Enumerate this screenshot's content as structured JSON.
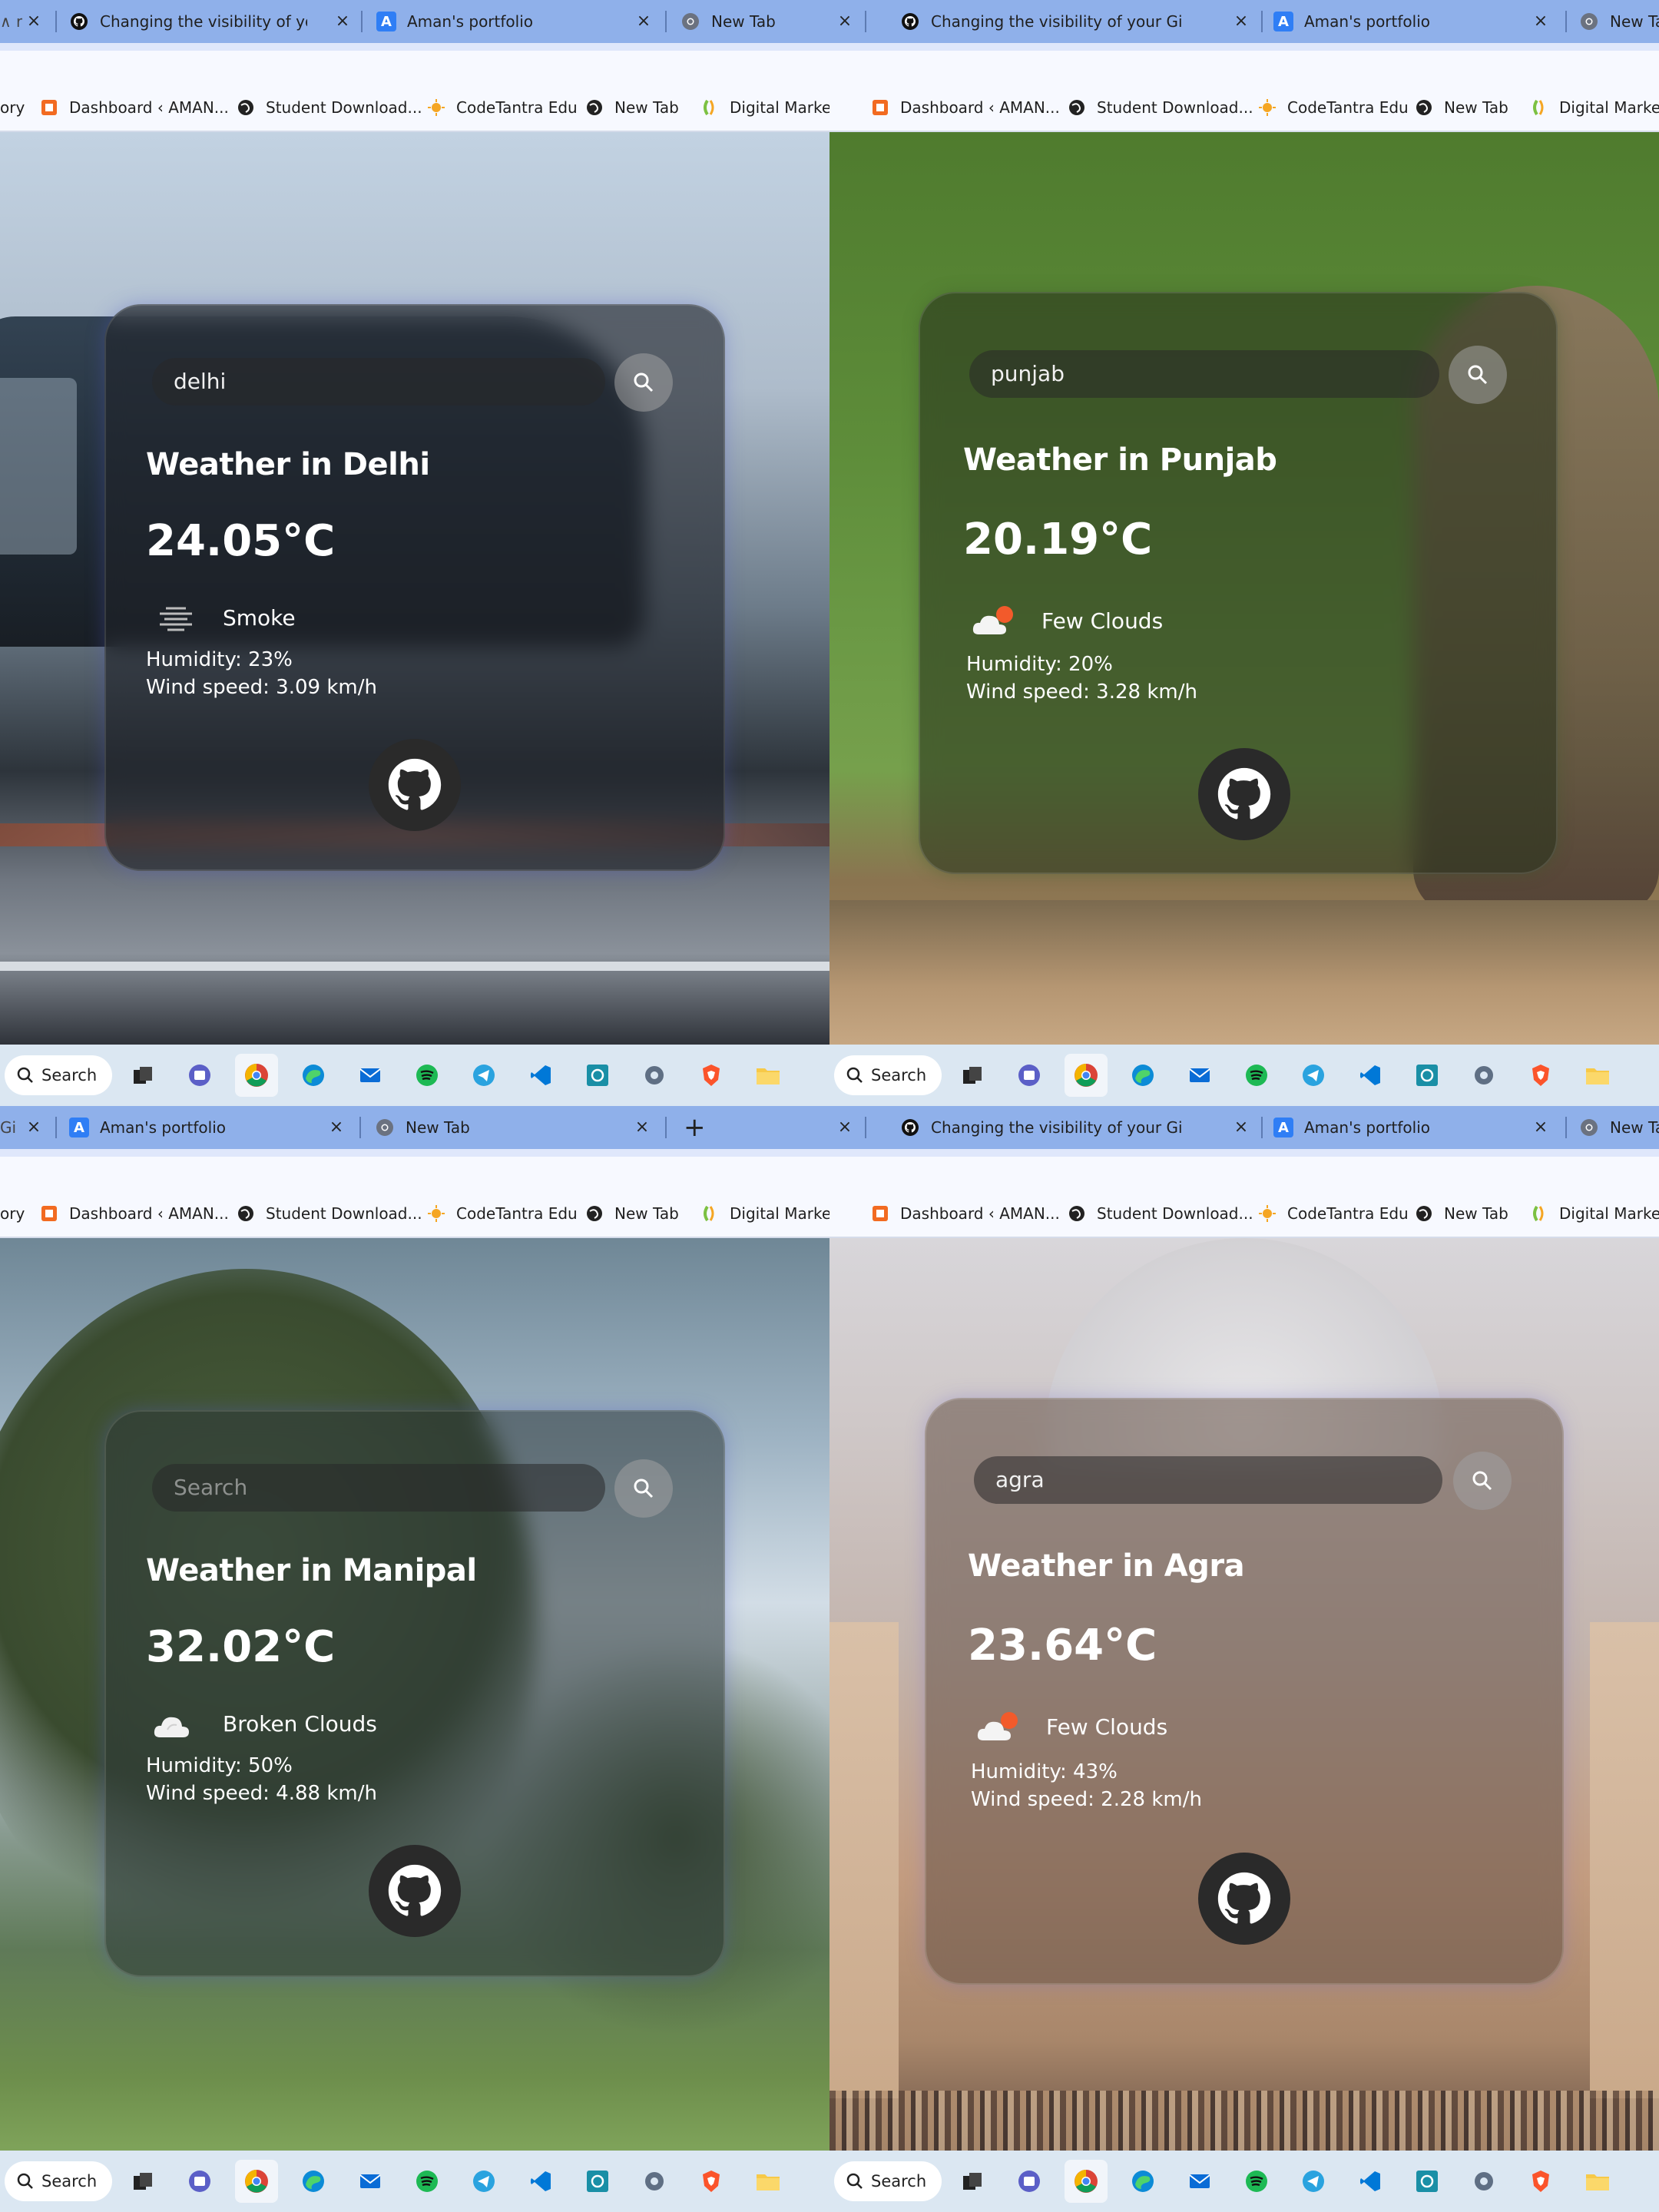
{
  "panels": [
    {
      "tabs": [
        {
          "label": "Changing the visibility of your Gi",
          "icon": "github-icon"
        },
        {
          "label": "Aman's portfolio",
          "icon": "portfolio-icon"
        },
        {
          "label": "New Tab",
          "icon": "chrome-icon"
        },
        {
          "label": "Changing the visibility of your Gi",
          "icon": "github-icon"
        },
        {
          "label": "Aman's portfolio",
          "icon": "portfolio-icon"
        },
        {
          "label": "New Tab",
          "icon": "chrome-icon"
        }
      ],
      "bookmarks": [
        "ory",
        "Dashboard ‹ AMAN...",
        "Student Download...",
        "CodeTantra Edu",
        "New Tab",
        "Digital Marketiory",
        "Dashboard ‹ AMAN...",
        "Student Download...",
        "CodeTantra Edu",
        "New Tab",
        "Digital Marketin"
      ],
      "weather": {
        "search_value": "delhi",
        "search_placeholder": "Search",
        "title": "Weather in Delhi",
        "temp": "24.05°C",
        "icon": "smoke-icon",
        "description": "Smoke",
        "humidity": "Humidity: 23%",
        "wind": "Wind speed: 3.09 km/h"
      },
      "taskbar_search": "Search"
    },
    {
      "tabs": [
        {
          "label": "Changing the visibility of your Gi",
          "icon": "github-icon"
        },
        {
          "label": "Aman's portfolio",
          "icon": "portfolio-icon"
        },
        {
          "label": "New Tab",
          "icon": "chrome-icon"
        }
      ],
      "bookmarks": [
        "Dashboard ‹ AMAN...",
        "Student Download...",
        "CodeTantra Edu",
        "New Tab",
        "Digital Marketin"
      ],
      "weather": {
        "search_value": "punjab",
        "search_placeholder": "Search",
        "title": "Weather in Punjab",
        "temp": "20.19°C",
        "icon": "few-clouds-icon",
        "description": "Few Clouds",
        "humidity": "Humidity: 20%",
        "wind": "Wind speed: 3.28 km/h"
      },
      "taskbar_search": "Search"
    },
    {
      "tabs": [
        {
          "label": "Gi",
          "icon": ""
        },
        {
          "label": "Aman's portfolio",
          "icon": "portfolio-icon"
        },
        {
          "label": "New Tab",
          "icon": "chrome-icon"
        }
      ],
      "new_tab_symbol": "+",
      "bookmarks": [
        "ory",
        "Dashboard ‹ AMAN...",
        "Student Download...",
        "CodeTantra Edu",
        "New Tab",
        "Digital Marketiory"
      ],
      "weather": {
        "search_value": "",
        "search_placeholder": "Search",
        "title": "Weather in Manipal",
        "temp": "32.02°C",
        "icon": "broken-clouds-icon",
        "description": "Broken Clouds",
        "humidity": "Humidity: 50%",
        "wind": "Wind speed: 4.88 km/h"
      },
      "taskbar_search": "Search"
    },
    {
      "tabs": [
        {
          "label": "Changing the visibility of your Gi",
          "icon": "github-icon"
        },
        {
          "label": "Aman's portfolio",
          "icon": "portfolio-icon"
        },
        {
          "label": "New Tab",
          "icon": "chrome-icon"
        }
      ],
      "bookmarks": [
        "Dashboard ‹ AMAN...",
        "Student Download...",
        "CodeTantra Edu",
        "New Tab",
        "Digital Marketin"
      ],
      "weather": {
        "search_value": "agra",
        "search_placeholder": "Search",
        "title": "Weather in Agra",
        "temp": "23.64°C",
        "icon": "few-clouds-icon",
        "description": "Few Clouds",
        "humidity": "Humidity: 43%",
        "wind": "Wind speed: 2.28 km/h"
      },
      "taskbar_search": "Search"
    }
  ],
  "colors": {
    "tab_strip": "#8fb0ea",
    "bookmark_bar": "#f7f9ff",
    "taskbar": "#dbe7f2",
    "card_text": "#ffffff"
  },
  "taskbar_icons": [
    "file-explorer-dark-icon",
    "teams-icon",
    "chrome-icon",
    "edge-icon",
    "mail-icon",
    "spotify-icon",
    "telegram-icon",
    "vscode-icon",
    "terminal-icon",
    "settings-icon",
    "brave-icon",
    "folder-icon",
    "app-icon"
  ]
}
